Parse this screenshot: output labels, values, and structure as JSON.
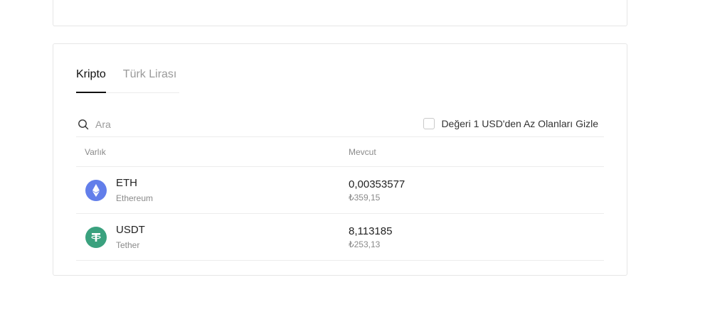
{
  "tabs": [
    {
      "label": "Kripto"
    },
    {
      "label": "Türk Lirası"
    }
  ],
  "search": {
    "placeholder": "Ara"
  },
  "filter": {
    "hide_small_label": "Değeri 1 USD'den Az Olanları Gizle"
  },
  "table": {
    "headers": {
      "asset": "Varlık",
      "available": "Mevcut"
    },
    "rows": [
      {
        "symbol": "ETH",
        "name": "Ethereum",
        "amount": "0,00353577",
        "fiat": "₺359,15",
        "icon": "ethereum-icon",
        "color": "#627eea"
      },
      {
        "symbol": "USDT",
        "name": "Tether",
        "amount": "8,113185",
        "fiat": "₺253,13",
        "icon": "tether-icon",
        "color": "#3aa17e"
      }
    ]
  }
}
